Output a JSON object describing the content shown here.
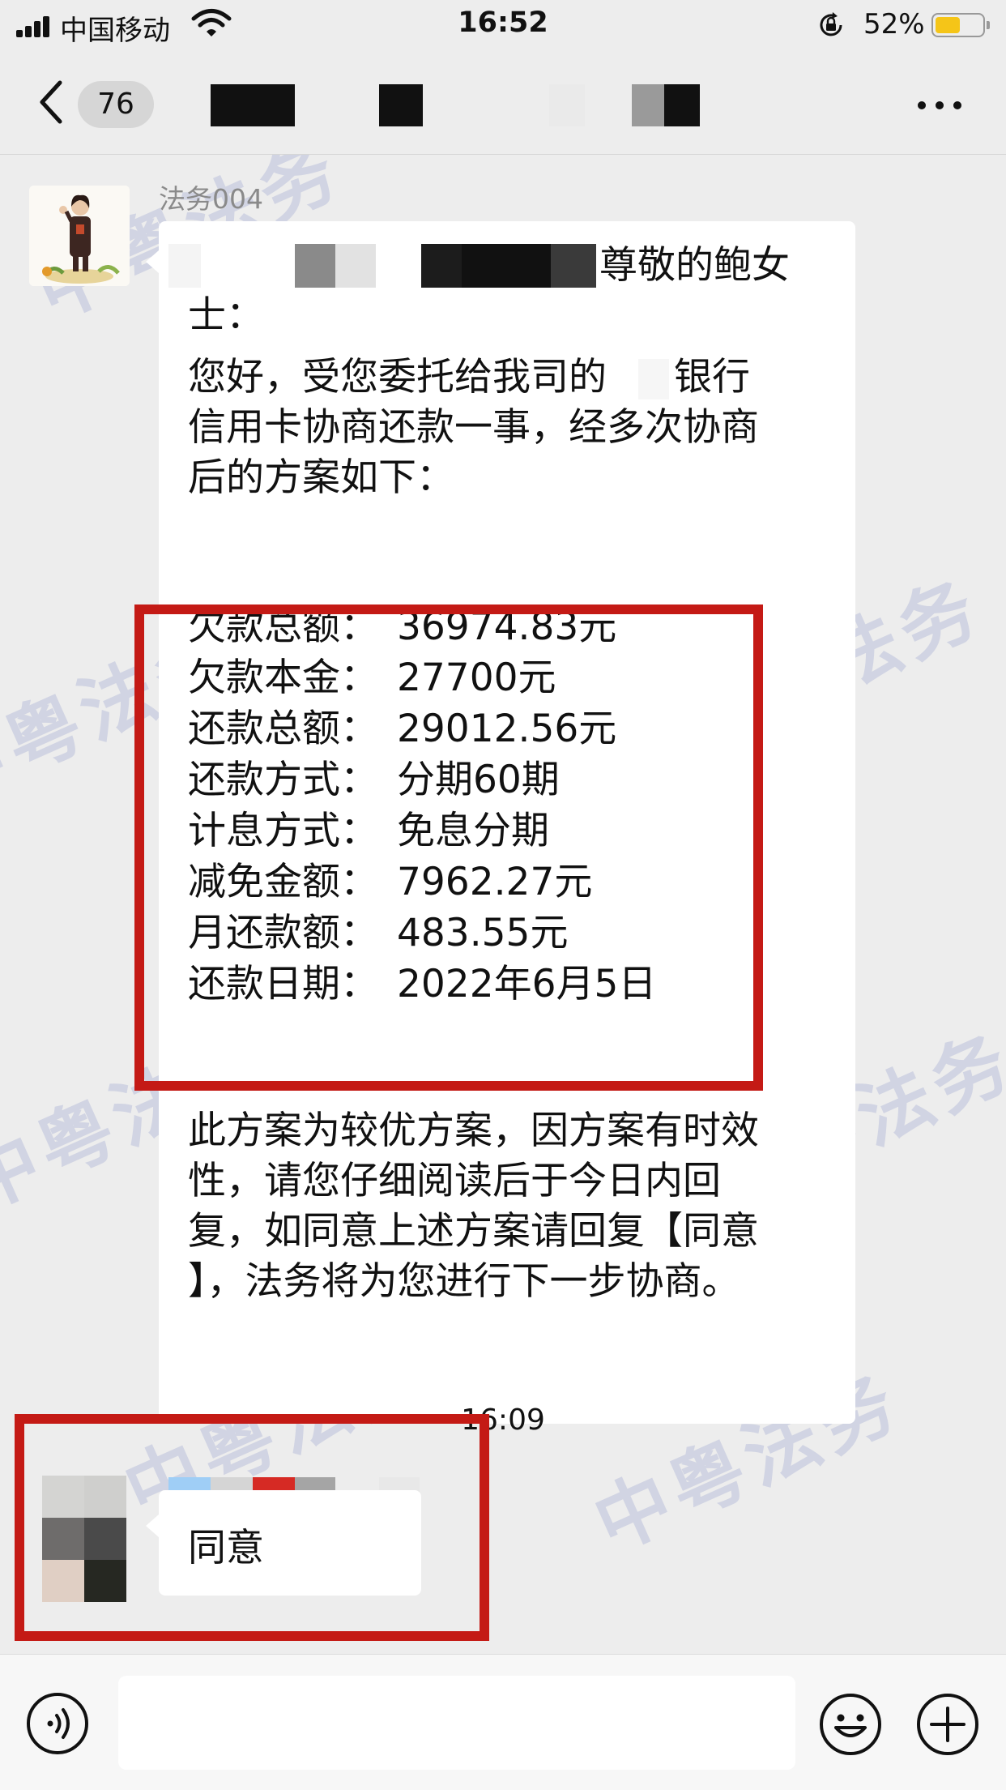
{
  "status_bar": {
    "carrier": "中国移动",
    "time": "16:52",
    "battery": "52%",
    "battery_level": 0.52
  },
  "nav": {
    "unread_count": "76"
  },
  "watermark": "中粤法务",
  "message1": {
    "sender": "法务004",
    "greeting": "尊敬的鲍女",
    "greeting_cont": "士：",
    "intro_lines": [
      "您好，受您委托给我司的",
      "银行",
      "信用卡协商还款一事，经多次协商",
      "后的方案如下："
    ],
    "plan": [
      {
        "label": "欠款总额：",
        "value": "36974.83元"
      },
      {
        "label": "欠款本金：",
        "value": "27700元"
      },
      {
        "label": "还款总额：",
        "value": "29012.56元"
      },
      {
        "label": "还款方式：",
        "value": "分期60期"
      },
      {
        "label": "计息方式：",
        "value": "免息分期"
      },
      {
        "label": "减免金额：",
        "value": "7962.27元"
      },
      {
        "label": "月还款额：",
        "value": "483.55元"
      },
      {
        "label": "还款日期：",
        "value": "2022年6月5日"
      }
    ],
    "closing_lines": [
      "此方案为较优方案，因方案有时效",
      "性，请您仔细阅读后于今日内回",
      "复，如同意上述方案请回复【同意",
      "】，法务将为您进行下一步协商。"
    ]
  },
  "timestamp": "16:09",
  "message2": {
    "text": "同意"
  },
  "colors": {
    "background": "#ededed",
    "bubble": "#ffffff",
    "highlight_box": "#c41a15",
    "battery": "#f5c518"
  },
  "icons": [
    "back-icon",
    "more-icon",
    "voice-icon",
    "emoji-icon",
    "plus-icon",
    "wifi-icon",
    "signal-icon",
    "rotation-lock-icon"
  ]
}
